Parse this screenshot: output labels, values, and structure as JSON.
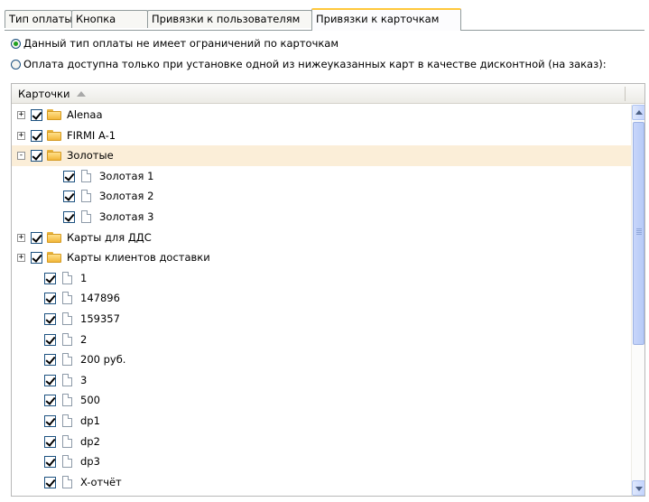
{
  "tabs": [
    {
      "label": "Тип оплаты",
      "active": false
    },
    {
      "label": "Кнопка",
      "active": false
    },
    {
      "label": "Привязки к пользователям",
      "active": false
    },
    {
      "label": "Привязки к карточкам",
      "active": true
    }
  ],
  "options": {
    "no_restrictions": {
      "label": "Данный тип оплаты не имеет ограничений по карточкам",
      "selected": true
    },
    "restricted": {
      "label": "Оплата доступна только при установке одной из нижеуказанных карт в качестве дисконтной (на заказ):",
      "selected": false
    }
  },
  "grid": {
    "column_header": "Карточки",
    "sort": "ascending",
    "rows": [
      {
        "label": "Alenaa",
        "type": "folder",
        "level": 0,
        "expander": "+",
        "checked": true
      },
      {
        "label": "FIRMI A-1",
        "type": "folder",
        "level": 0,
        "expander": "+",
        "checked": true
      },
      {
        "label": "Золотые",
        "type": "folder",
        "level": 0,
        "expander": "−",
        "checked": true,
        "selected": true
      },
      {
        "label": "Золотая 1",
        "type": "file",
        "level": 1,
        "expander": "",
        "checked": true
      },
      {
        "label": "Золотая 2",
        "type": "file",
        "level": 1,
        "expander": "",
        "checked": true
      },
      {
        "label": "Золотая 3",
        "type": "file",
        "level": 1,
        "expander": "",
        "checked": true
      },
      {
        "label": "Карты для ДДС",
        "type": "folder",
        "level": 0,
        "expander": "+",
        "checked": true
      },
      {
        "label": "Карты клиентов доставки",
        "type": "folder",
        "level": 0,
        "expander": "+",
        "checked": true
      },
      {
        "label": "1",
        "type": "file",
        "level": 0,
        "expander": "",
        "checked": true
      },
      {
        "label": "147896",
        "type": "file",
        "level": 0,
        "expander": "",
        "checked": true
      },
      {
        "label": "159357",
        "type": "file",
        "level": 0,
        "expander": "",
        "checked": true
      },
      {
        "label": "2",
        "type": "file",
        "level": 0,
        "expander": "",
        "checked": true
      },
      {
        "label": "200 руб.",
        "type": "file",
        "level": 0,
        "expander": "",
        "checked": true
      },
      {
        "label": "3",
        "type": "file",
        "level": 0,
        "expander": "",
        "checked": true
      },
      {
        "label": "500",
        "type": "file",
        "level": 0,
        "expander": "",
        "checked": true
      },
      {
        "label": "dp1",
        "type": "file",
        "level": 0,
        "expander": "",
        "checked": true
      },
      {
        "label": "dp2",
        "type": "file",
        "level": 0,
        "expander": "",
        "checked": true
      },
      {
        "label": "dp3",
        "type": "file",
        "level": 0,
        "expander": "",
        "checked": true
      },
      {
        "label": "X-отчёт",
        "type": "file",
        "level": 0,
        "expander": "",
        "checked": true
      }
    ]
  },
  "scrollbar": {
    "position": 0.0
  }
}
